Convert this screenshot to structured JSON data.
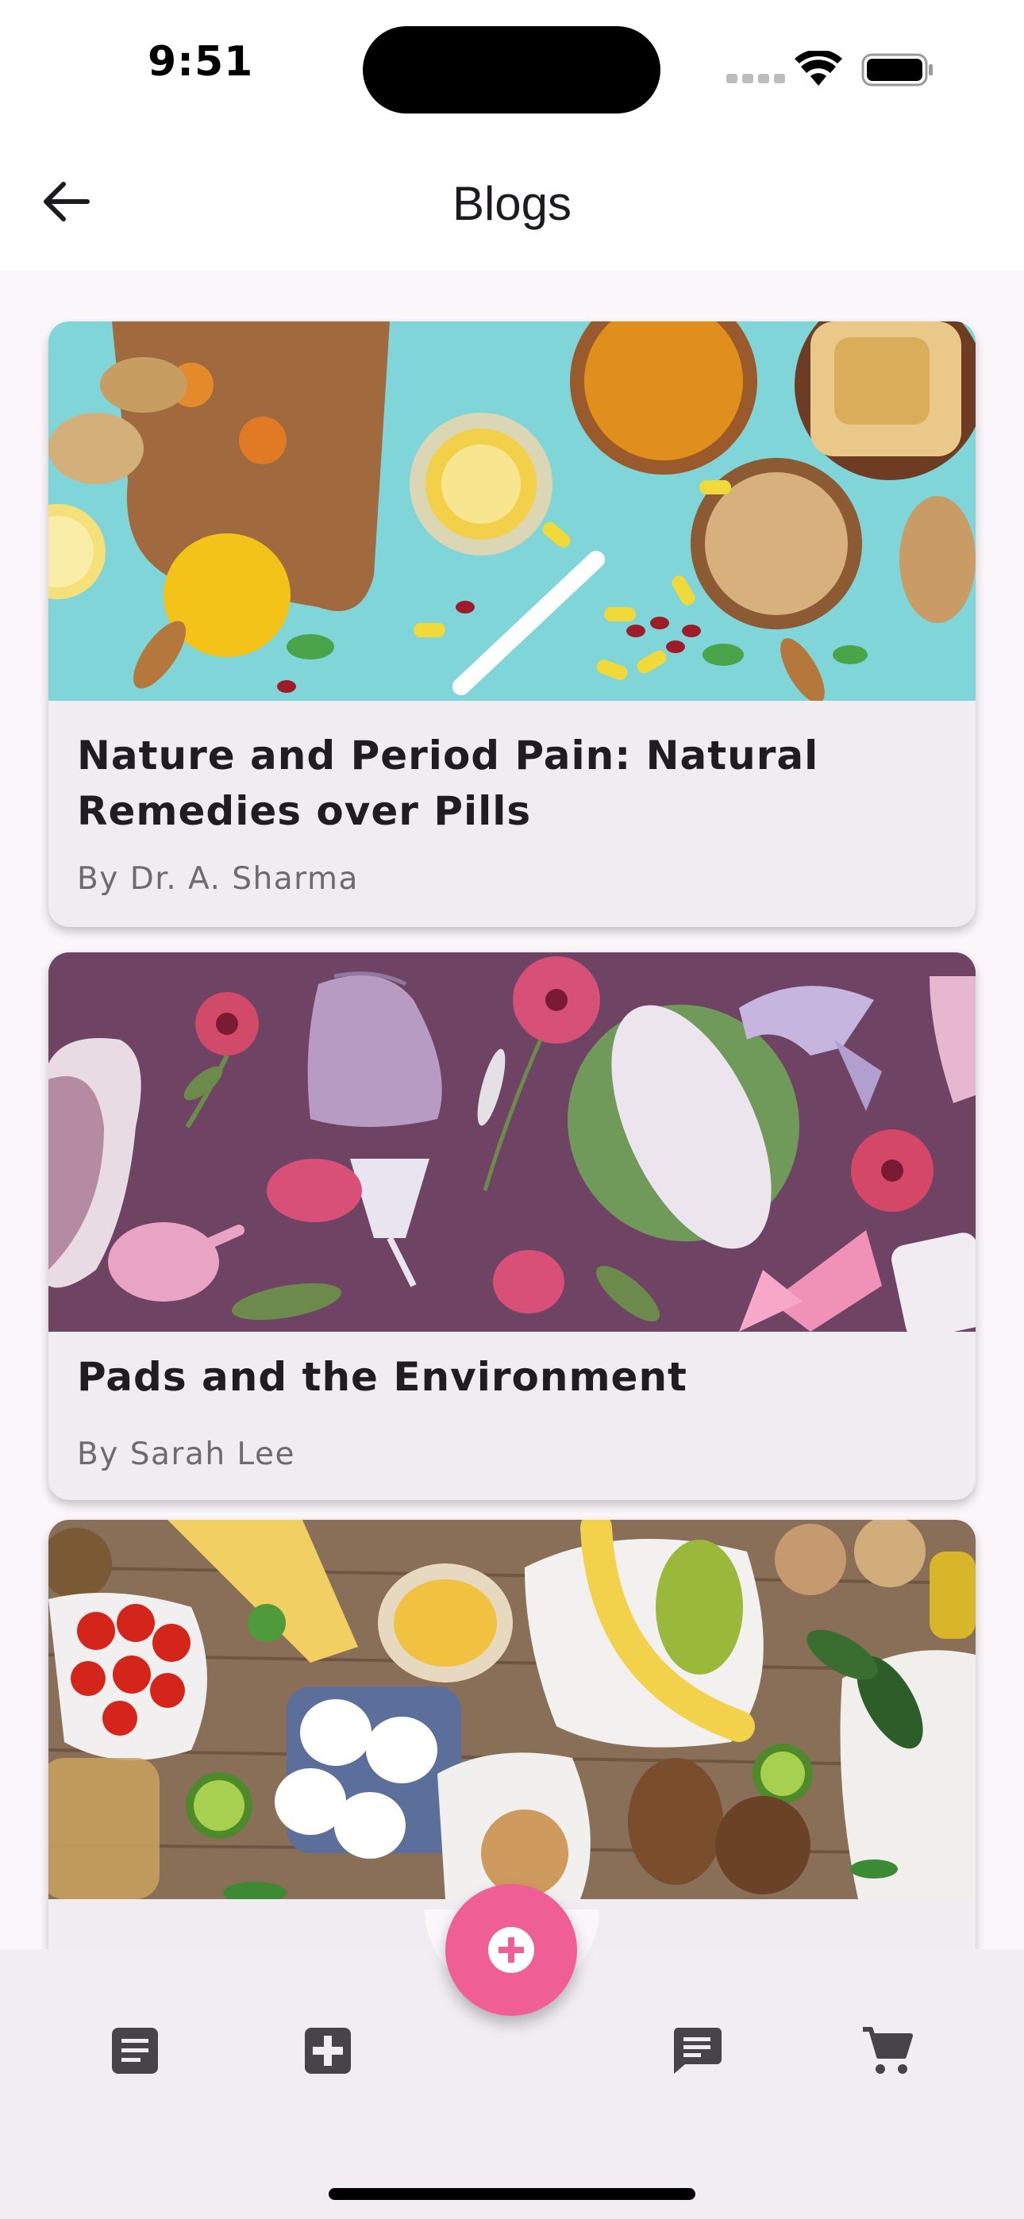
{
  "status_bar": {
    "time": "9:51"
  },
  "app_bar": {
    "title": "Blogs"
  },
  "blogs": [
    {
      "title": "Nature and Period Pain: Natural Remedies over Pills",
      "author": "By Dr. A. Sharma",
      "image": "herbal-remedies-flatlay"
    },
    {
      "title": "Pads and the Environment",
      "author": "By Sarah Lee",
      "image": "reusable-menstrual-products"
    },
    {
      "title": "",
      "author": "",
      "image": "zero-waste-groceries"
    }
  ],
  "fab": {
    "icon": "add-circle-icon"
  },
  "bottom_nav": {
    "items": [
      {
        "icon": "article-icon"
      },
      {
        "icon": "medical-plus-icon"
      },
      {
        "icon": "chat-icon"
      },
      {
        "icon": "cart-icon"
      }
    ]
  },
  "colors": {
    "accent": "#ef5f95",
    "card_bg": "#efecf2",
    "nav_bg": "#f1edf3",
    "page_bg": "#fbf6fa"
  }
}
